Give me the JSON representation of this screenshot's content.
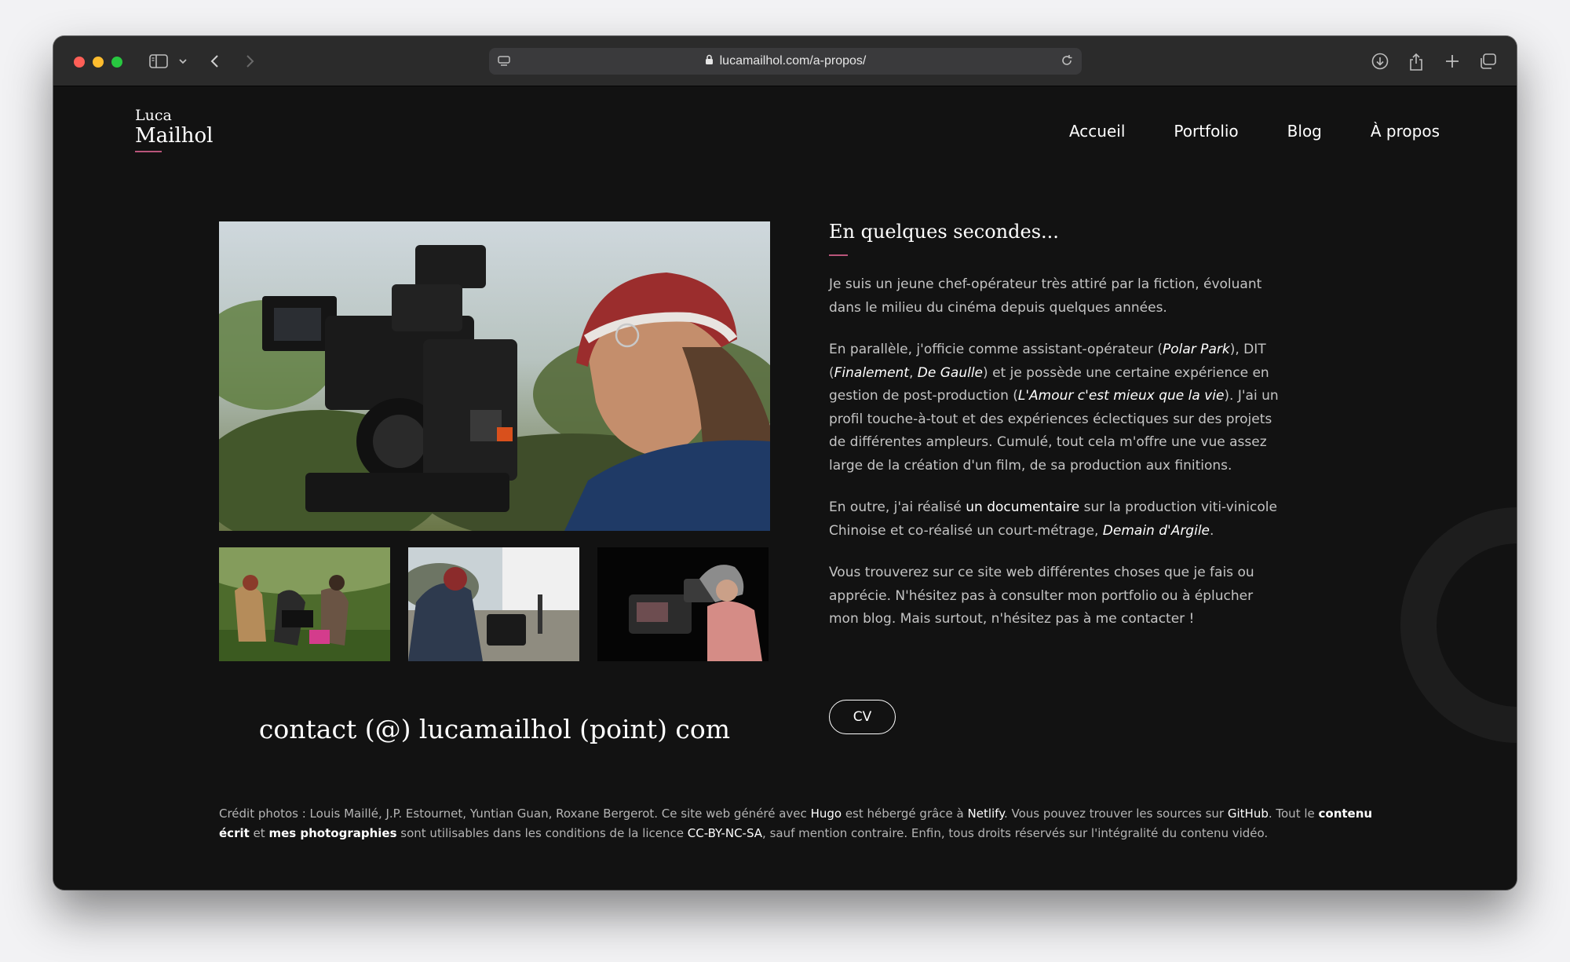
{
  "browser": {
    "url": "lucamailhol.com/a-propos/"
  },
  "logo": {
    "first": "Luca",
    "last": "Mailhol"
  },
  "nav": {
    "items": [
      "Accueil",
      "Portfolio",
      "Blog",
      "À propos"
    ]
  },
  "photos": {
    "main": "Photo of a smiling camera operator with a red knit hat next to an ARRI cinema camera",
    "thumb1": "Film crew working on a set outdoors",
    "thumb2": "Camera operator filming outdoors",
    "thumb3": "Camera operator with a cinema camera in the dark"
  },
  "contact": "contact (@) lucamailhol (point) com",
  "about": {
    "heading": "En quelques secondes...",
    "p1": "Je suis un jeune chef-opérateur très attiré par la fiction, évoluant dans le milieu du cinéma depuis quelques années.",
    "p2": {
      "a": "En parallèle, j'officie comme assistant-opérateur (",
      "polar": "Polar Park",
      "b": "), DIT (",
      "finalement": "Finalement",
      "c": ", ",
      "degaulle": "De Gaulle",
      "d": ") et je possède une certaine expérience en gestion de post-production (",
      "amour": "L'Amour c'est mieux que la vie",
      "e": "). J'ai un profil touche-à-tout et des expériences éclectiques sur des projets de différentes ampleurs. Cumulé, tout cela m'offre une vue assez large de la création d'un film, de sa production aux finitions."
    },
    "p3": {
      "a": "En outre, j'ai réalisé ",
      "doc": "un documentaire",
      "b": " sur la production viti-vinicole Chinoise et co-réalisé un court-métrage, ",
      "demain": "Demain d'Argile",
      "c": "."
    },
    "p4": "Vous trouverez sur ce site web différentes choses que je fais ou apprécie. N'hésitez pas à consulter mon portfolio ou à éplucher mon blog. Mais surtout, n'hésitez pas à me contacter !",
    "cv": "CV"
  },
  "footer": {
    "a": "Crédit photos : Louis Maillé, J.P. Estournet, Yuntian Guan, Roxane Bergerot. Ce site web généré avec ",
    "hugo": "Hugo",
    "b": " est hébergé grâce à ",
    "netlify": "Netlify",
    "c": ". Vous pouvez trouver les sources sur ",
    "github": "GitHub",
    "d": ". Tout le ",
    "contenu": "contenu écrit",
    "e": " et ",
    "photos": "mes photographies",
    "f": " sont utilisables dans les conditions de la licence ",
    "license": "CC-BY-NC-SA",
    "g": ", sauf mention contraire. Enfin, tous droits réservés sur l'intégralité du contenu vidéo."
  },
  "colors": {
    "accent": "#b9557a",
    "background": "#121212"
  }
}
